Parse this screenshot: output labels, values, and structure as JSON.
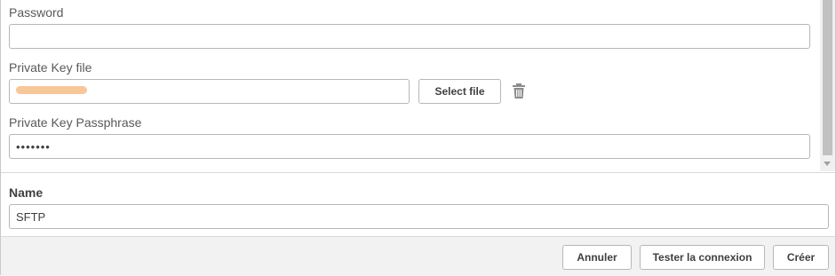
{
  "form": {
    "password": {
      "label": "Password",
      "value": ""
    },
    "private_key_file": {
      "label": "Private Key file",
      "value": "",
      "select_label": "Select file",
      "delete_icon": "trash-icon"
    },
    "passphrase": {
      "label": "Private Key Passphrase",
      "value": "•••••••"
    },
    "name": {
      "label": "Name",
      "value": "SFTP"
    }
  },
  "footer": {
    "cancel_label": "Annuler",
    "test_label": "Tester la connexion",
    "create_label": "Créer"
  }
}
